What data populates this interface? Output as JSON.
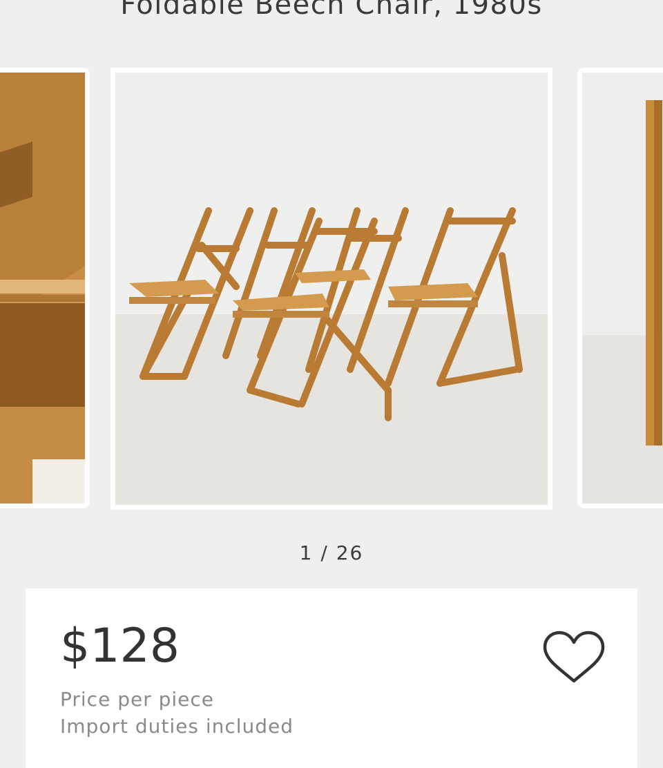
{
  "product": {
    "title": "Foldable Beech Chair, 1980s"
  },
  "gallery": {
    "current_index": 1,
    "total": 26,
    "pager_text": "1 / 26"
  },
  "pricing": {
    "price": "$128",
    "unit_note": "Price per piece",
    "duty_note": "Import duties included"
  },
  "icons": {
    "favorite": "heart-outline-icon"
  },
  "colors": {
    "background": "#efefef",
    "card": "#ffffff",
    "text_primary": "#333333",
    "text_secondary": "#8a8a8a",
    "wood": "#c98a3a"
  }
}
